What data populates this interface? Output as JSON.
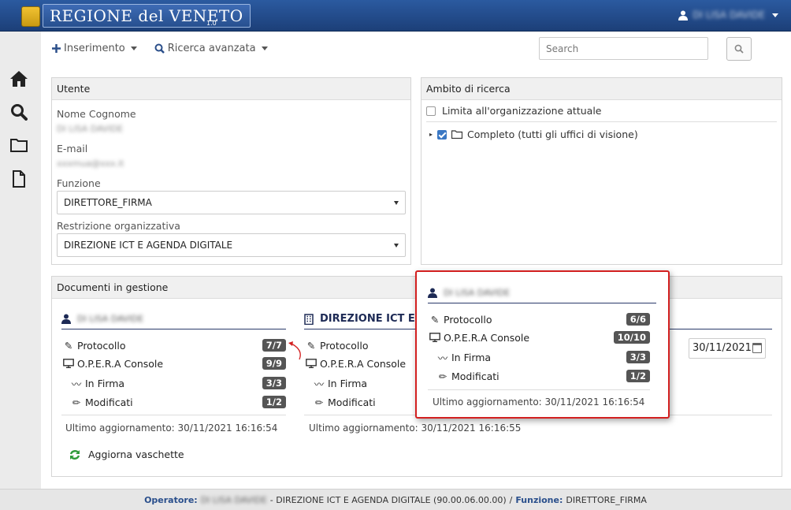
{
  "header": {
    "brand_main": "REGIONE del VENETO",
    "version": "1.0",
    "user_name": "DI LISA DAVIDE"
  },
  "toolbar": {
    "insert_label": "Inserimento",
    "advanced_search_label": "Ricerca avanzata",
    "search_placeholder": "Search"
  },
  "utente": {
    "title": "Utente",
    "name_label": "Nome Cognome",
    "name_value": "DI LISA DAVIDE",
    "email_label": "E-mail",
    "email_value": "xxxmua@xxx.it",
    "funzione_label": "Funzione",
    "funzione_value": "DIRETTORE_FIRMA",
    "restrizione_label": "Restrizione organizzativa",
    "restrizione_value": "DIREZIONE ICT E AGENDA DIGITALE"
  },
  "ambito": {
    "title": "Ambito di ricerca",
    "limit_label": "Limita all'organizzazione attuale",
    "complete_label": "Completo (tutti gli uffici di visione)"
  },
  "documenti": {
    "title": "Documenti in gestione",
    "date_value": "30/11/2021",
    "refresh_label": "Aggiorna vaschette",
    "groups": [
      {
        "title": "DI LISA DAVIDE",
        "rows": [
          {
            "label": "Protocollo",
            "count": "7/7"
          },
          {
            "label": "O.P.E.R.A Console",
            "count": "9/9"
          },
          {
            "label": "In Firma",
            "count": "3/3"
          },
          {
            "label": "Modificati",
            "count": "1/2"
          }
        ],
        "updated": "Ultimo aggiornamento: 30/11/2021 16:16:54"
      },
      {
        "title": "DIREZIONE ICT E AGE",
        "rows": [
          {
            "label": "Protocollo"
          },
          {
            "label": "O.P.E.R.A Console"
          },
          {
            "label": "In Firma"
          },
          {
            "label": "Modificati"
          }
        ],
        "updated": "Ultimo aggiornamento: 30/11/2021 16:16:55"
      }
    ]
  },
  "popup": {
    "title": "DI LISA DAVIDE",
    "rows": [
      {
        "label": "Protocollo",
        "count": "6/6"
      },
      {
        "label": "O.P.E.R.A Console",
        "count": "10/10"
      },
      {
        "label": "In Firma",
        "count": "3/3"
      },
      {
        "label": "Modificati",
        "count": "1/2"
      }
    ],
    "updated": "Ultimo aggiornamento: 30/11/2021 16:16:54"
  },
  "footer": {
    "operatore_key": "Operatore:",
    "operatore_name": "DI LISA DAVIDE",
    "org": "- DIREZIONE ICT E AGENDA DIGITALE (90.00.06.00.00)",
    "sep": "/",
    "funzione_key": "Funzione:",
    "funzione_value": "DIRETTORE_FIRMA"
  }
}
